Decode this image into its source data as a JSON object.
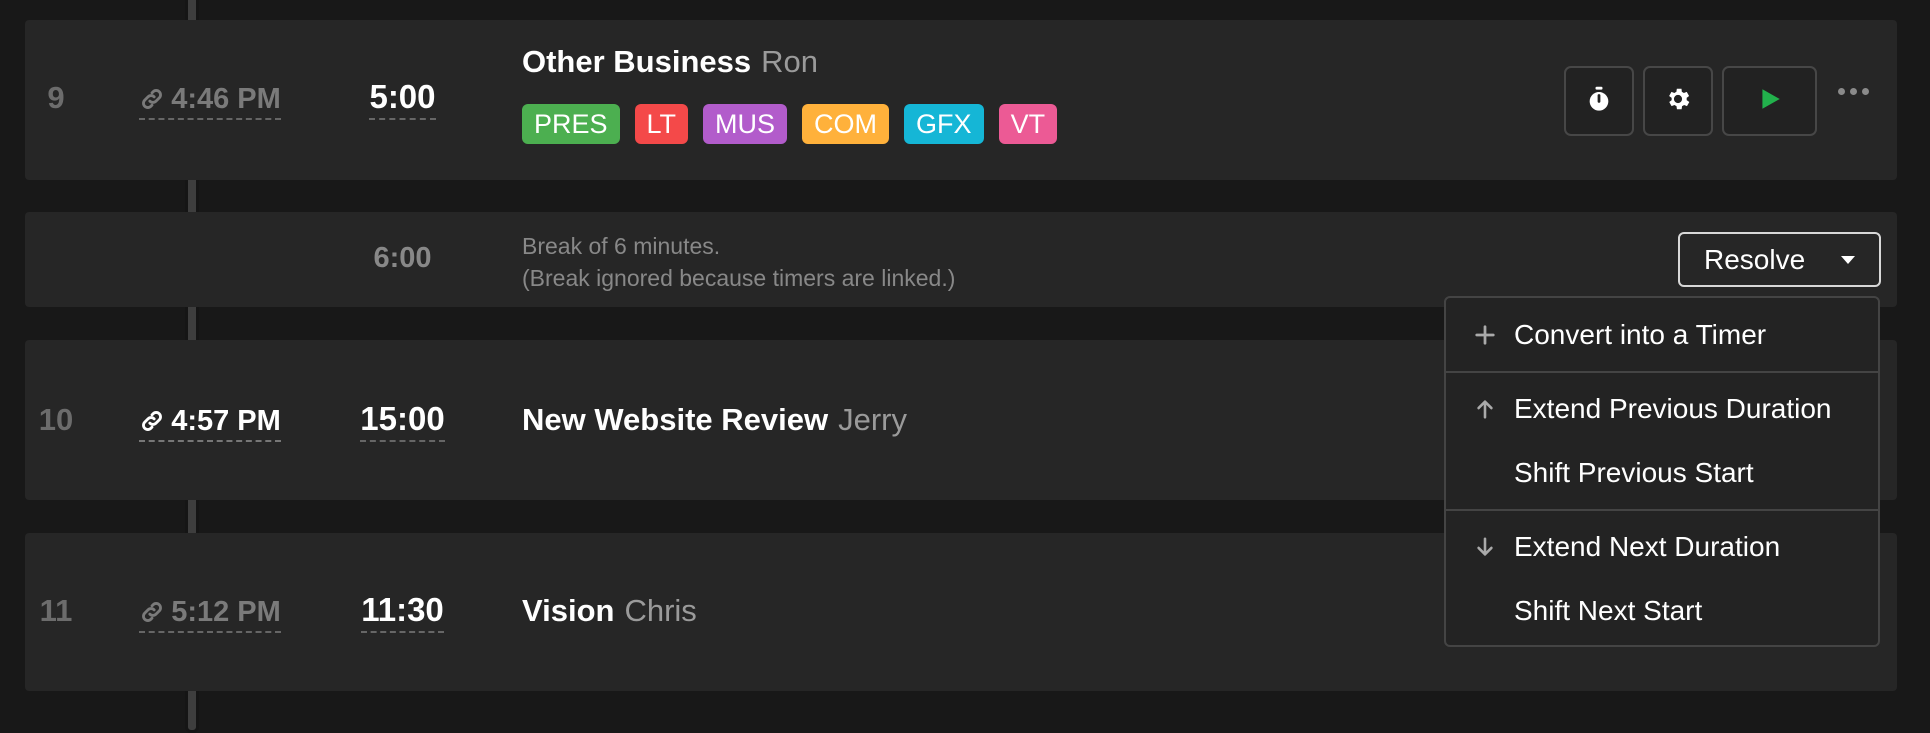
{
  "rows": [
    {
      "number": "9",
      "start": "4:46 PM",
      "duration": "5:00",
      "title": "Other Business",
      "presenter": "Ron",
      "tags": [
        {
          "label": "PRES",
          "color": "#4caf50"
        },
        {
          "label": "LT",
          "color": "#f44949"
        },
        {
          "label": "MUS",
          "color": "#b25ccb"
        },
        {
          "label": "COM",
          "color": "#ffb13b"
        },
        {
          "label": "GFX",
          "color": "#15b6d6"
        },
        {
          "label": "VT",
          "color": "#ec5a95"
        }
      ],
      "actions": [
        "stopwatch-icon",
        "gear-icon",
        "play-icon",
        "more-icon"
      ]
    },
    {
      "number": "10",
      "start": "4:57 PM",
      "duration": "15:00",
      "title": "New Website Review",
      "presenter": "Jerry"
    },
    {
      "number": "11",
      "start": "5:12 PM",
      "duration": "11:30",
      "title": "Vision",
      "presenter": "Chris"
    }
  ],
  "break": {
    "duration": "6:00",
    "line1": "Break of 6 minutes.",
    "line2": "(Break ignored because timers are linked.)"
  },
  "resolve": {
    "label": "Resolve",
    "menu": [
      {
        "label": "Convert into a Timer",
        "icon": "plus-icon"
      },
      {
        "label": "Extend Previous Duration",
        "icon": "arrow-up-icon"
      },
      {
        "label": "Shift Previous Start",
        "icon": ""
      },
      {
        "label": "Extend Next Duration",
        "icon": "arrow-down-icon"
      },
      {
        "label": "Shift Next Start",
        "icon": ""
      }
    ]
  },
  "colors": {
    "background": "#181818",
    "row": "#262626",
    "play": "#22b14c"
  }
}
